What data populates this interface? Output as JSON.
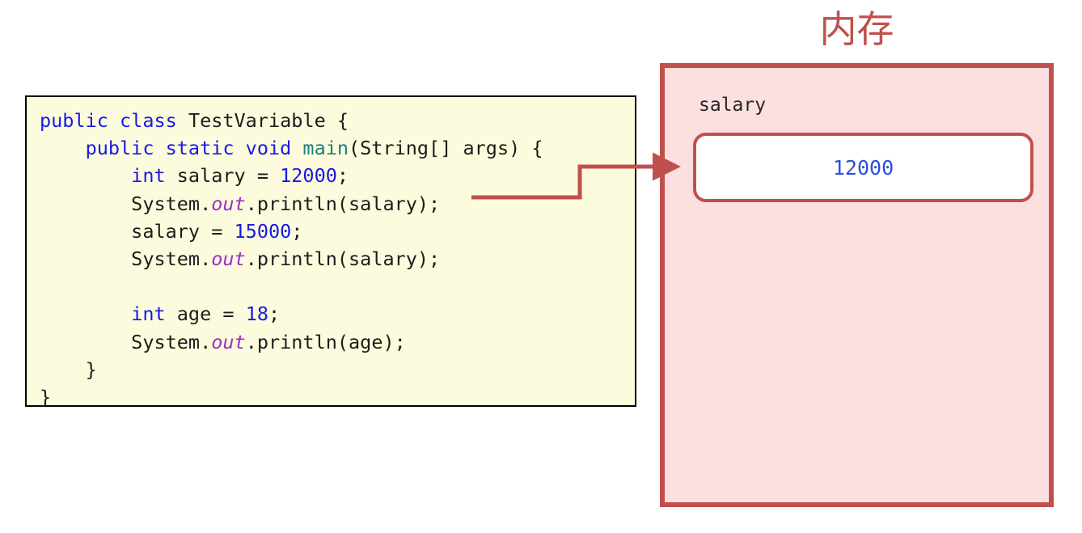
{
  "code_panel": {
    "language": "java",
    "background_color": "#fcfbdd",
    "border_color": "#000000",
    "lines": [
      {
        "id": "line-1",
        "text": "public class TestVariable {",
        "tokens": [
          {
            "t": "public class ",
            "c": "kw"
          },
          {
            "t": "TestVariable {",
            "c": "pln"
          }
        ]
      },
      {
        "id": "line-2",
        "text": "    public static void main(String[] args) {",
        "tokens": [
          {
            "t": "    ",
            "c": "pln"
          },
          {
            "t": "public static void ",
            "c": "kw"
          },
          {
            "t": "main",
            "c": "mth"
          },
          {
            "t": "(String[] args) {",
            "c": "pln"
          }
        ]
      },
      {
        "id": "line-3",
        "text": "        int salary = 12000;",
        "tokens": [
          {
            "t": "        ",
            "c": "pln"
          },
          {
            "t": "int",
            "c": "kw"
          },
          {
            "t": " salary = ",
            "c": "pln"
          },
          {
            "t": "12000",
            "c": "num"
          },
          {
            "t": ";",
            "c": "pln"
          }
        ]
      },
      {
        "id": "line-4",
        "text": "        System.out.println(salary);",
        "tokens": [
          {
            "t": "        System.",
            "c": "pln"
          },
          {
            "t": "out",
            "c": "fld"
          },
          {
            "t": ".println(salary);",
            "c": "pln"
          }
        ]
      },
      {
        "id": "line-5",
        "text": "        salary = 15000;",
        "tokens": [
          {
            "t": "        salary = ",
            "c": "pln"
          },
          {
            "t": "15000",
            "c": "num"
          },
          {
            "t": ";",
            "c": "pln"
          }
        ]
      },
      {
        "id": "line-6",
        "text": "        System.out.println(salary);",
        "tokens": [
          {
            "t": "        System.",
            "c": "pln"
          },
          {
            "t": "out",
            "c": "fld"
          },
          {
            "t": ".println(salary);",
            "c": "pln"
          }
        ]
      },
      {
        "id": "line-7",
        "text": "",
        "tokens": [
          {
            "t": " ",
            "c": "pln"
          }
        ]
      },
      {
        "id": "line-8",
        "text": "        int age = 18;",
        "tokens": [
          {
            "t": "        ",
            "c": "pln"
          },
          {
            "t": "int",
            "c": "kw"
          },
          {
            "t": " age = ",
            "c": "pln"
          },
          {
            "t": "18",
            "c": "num"
          },
          {
            "t": ";",
            "c": "pln"
          }
        ]
      },
      {
        "id": "line-9",
        "text": "        System.out.println(age);",
        "tokens": [
          {
            "t": "        System.",
            "c": "pln"
          },
          {
            "t": "out",
            "c": "fld"
          },
          {
            "t": ".println(age);",
            "c": "pln"
          }
        ]
      },
      {
        "id": "line-10",
        "text": "    }",
        "tokens": [
          {
            "t": "    }",
            "c": "pln"
          }
        ]
      },
      {
        "id": "line-11",
        "text": "}",
        "tokens": [
          {
            "t": "}",
            "c": "pln"
          }
        ]
      }
    ]
  },
  "memory": {
    "title": "内存",
    "title_color": "#c0504d",
    "box_background": "#fce0e0",
    "box_border_color": "#c0504d",
    "variable_label": "salary",
    "value": "12000",
    "value_color": "#2b4fd8",
    "value_box_background": "#ffffff"
  },
  "connector": {
    "color": "#c0504d",
    "description": "arrow from println(salary) to memory value box"
  },
  "colors": {
    "keyword": "#1919e6",
    "number": "#1919e6",
    "method": "#1a7f7f",
    "field": "#9b30c4",
    "plain": "#1c1c1c",
    "accent_red": "#c0504d"
  }
}
